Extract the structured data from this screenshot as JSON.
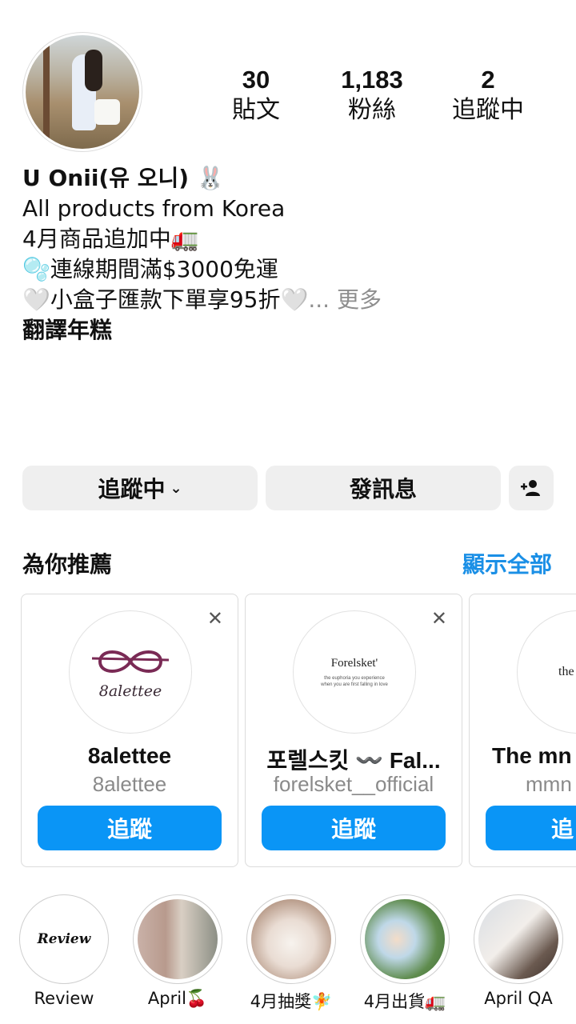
{
  "profile": {
    "stats": [
      {
        "value": "30",
        "label": "貼文"
      },
      {
        "value": "1,183",
        "label": "粉絲"
      },
      {
        "value": "2",
        "label": "追蹤中"
      }
    ],
    "bio": {
      "name": "U Onii(유 오니) 🐰",
      "line1": "All products from Korea",
      "line2": "4月商品追加中🚛",
      "line3": "🫧連線期間滿$3000免運",
      "line4": "🤍小盒子匯款下單享95折🤍",
      "more": "... 更多",
      "translate": "翻譯年糕"
    }
  },
  "actions": {
    "following_label": "追蹤中",
    "message_label": "發訊息"
  },
  "suggestions": {
    "title": "為你推薦",
    "show_all": "顯示全部",
    "close_glyph": "✕",
    "cards": [
      {
        "logo_text": "8alettee",
        "name": "8alettee",
        "handle": "8alettee",
        "button": "追蹤"
      },
      {
        "logo_text": "Forelsket'",
        "logo_sub": "the euphoria you experience when you are first falling in love",
        "name": "포렐스킷 〰️ Fal...",
        "handle": "forelsket__official",
        "button": "追蹤"
      },
      {
        "logo_text": "the MMN",
        "name": "The mn",
        "handle": "mmn",
        "button": "追"
      }
    ]
  },
  "highlights": [
    {
      "label": "Review",
      "cover_text": "Review"
    },
    {
      "label": "April🍒"
    },
    {
      "label": "4月抽獎🧚"
    },
    {
      "label": "4月出貨🚛"
    },
    {
      "label": "April QA"
    }
  ]
}
